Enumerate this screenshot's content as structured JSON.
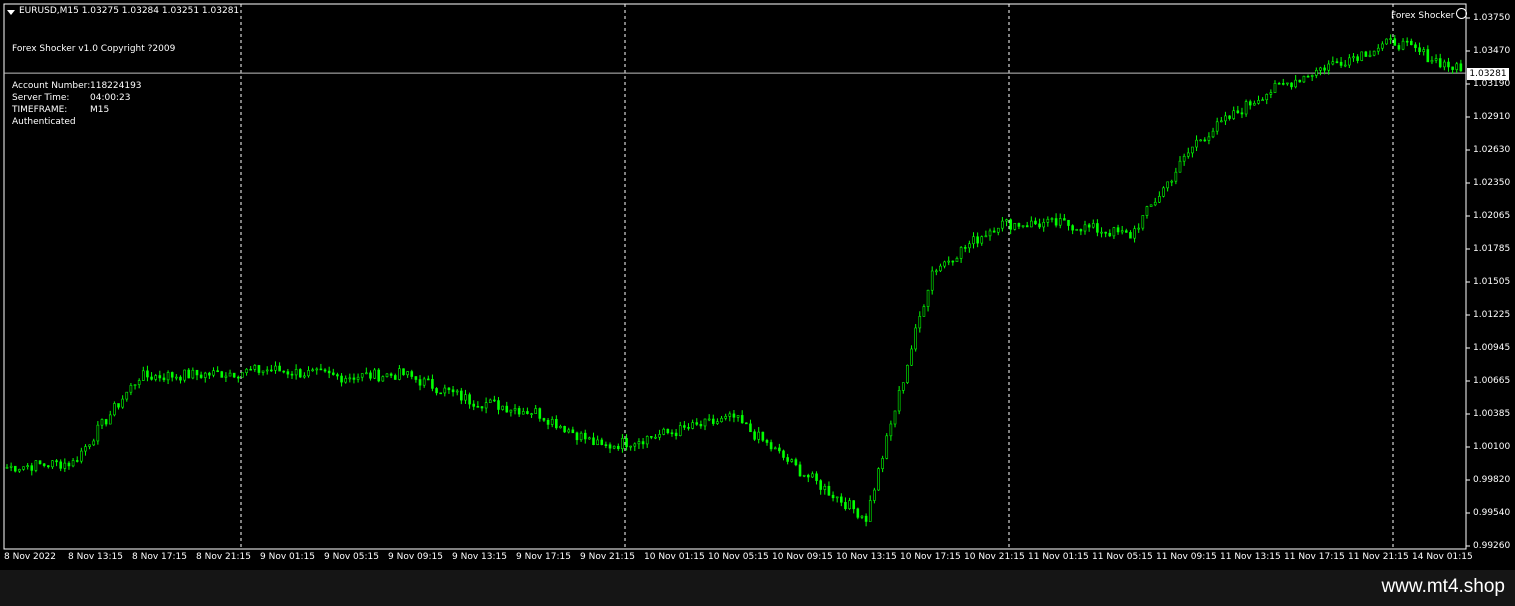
{
  "header": {
    "symbol_line": "EURUSD,M15  1.03275 1.03284 1.03251 1.03281",
    "indicator_name": "Forex Shocker v1.0 Copyright ?2009",
    "brand": "Forex Shocker"
  },
  "account_info": [
    {
      "label": "Account Number:",
      "value": "118224193"
    },
    {
      "label": "Server Time:",
      "value": "04:00:23"
    },
    {
      "label": "TIMEFRAME:",
      "value": "M15"
    },
    {
      "label": "Authenticated",
      "value": ""
    }
  ],
  "price_axis": [
    "1.03750",
    "1.03470",
    "1.03190",
    "1.02910",
    "1.02630",
    "1.02350",
    "1.02065",
    "1.01785",
    "1.01505",
    "1.01225",
    "1.00945",
    "1.00665",
    "1.00385",
    "1.00100",
    "0.99820",
    "0.99540",
    "0.99260"
  ],
  "current_price": "1.03281",
  "time_axis": [
    "8 Nov 2022",
    "8 Nov 13:15",
    "8 Nov 17:15",
    "8 Nov 21:15",
    "9 Nov 01:15",
    "9 Nov 05:15",
    "9 Nov 09:15",
    "9 Nov 13:15",
    "9 Nov 17:15",
    "9 Nov 21:15",
    "10 Nov 01:15",
    "10 Nov 05:15",
    "10 Nov 09:15",
    "10 Nov 13:15",
    "10 Nov 17:15",
    "10 Nov 21:15",
    "11 Nov 01:15",
    "11 Nov 05:15",
    "11 Nov 09:15",
    "11 Nov 13:15",
    "11 Nov 17:15",
    "11 Nov 21:15",
    "14 Nov 01:15"
  ],
  "colors": {
    "background": "#000000",
    "candle": "#00ff00",
    "grid_separator": "#ffffff",
    "bid_line": "#c0c0c0"
  },
  "chart_data": {
    "type": "line",
    "symbol": "EURUSD",
    "timeframe": "M15",
    "x": [
      "8 Nov 2022",
      "8 Nov 13:15",
      "8 Nov 17:15",
      "8 Nov 21:15",
      "9 Nov 01:15",
      "9 Nov 05:15",
      "9 Nov 09:15",
      "9 Nov 13:15",
      "9 Nov 17:15",
      "9 Nov 21:15",
      "10 Nov 01:15",
      "10 Nov 05:15",
      "10 Nov 09:15",
      "10 Nov 13:15",
      "10 Nov 17:15",
      "10 Nov 21:15",
      "11 Nov 01:15",
      "11 Nov 05:15",
      "11 Nov 09:15",
      "11 Nov 13:15",
      "11 Nov 17:15",
      "11 Nov 21:15",
      "14 Nov 01:15"
    ],
    "series": [
      {
        "values": [
          0.9993,
          0.9997,
          1.007,
          1.0072,
          1.0076,
          1.007,
          1.0072,
          1.005,
          1.004,
          1.001,
          1.0022,
          1.0035,
          0.999,
          0.995,
          1.016,
          1.02,
          1.02,
          1.019,
          1.027,
          1.031,
          1.0335,
          1.0355,
          1.033
        ]
      }
    ],
    "ylim": [
      0.9926,
      1.0375
    ],
    "grid": false,
    "last_price": 1.03281
  },
  "footer": {
    "watermark": "www.mt4.shop"
  }
}
